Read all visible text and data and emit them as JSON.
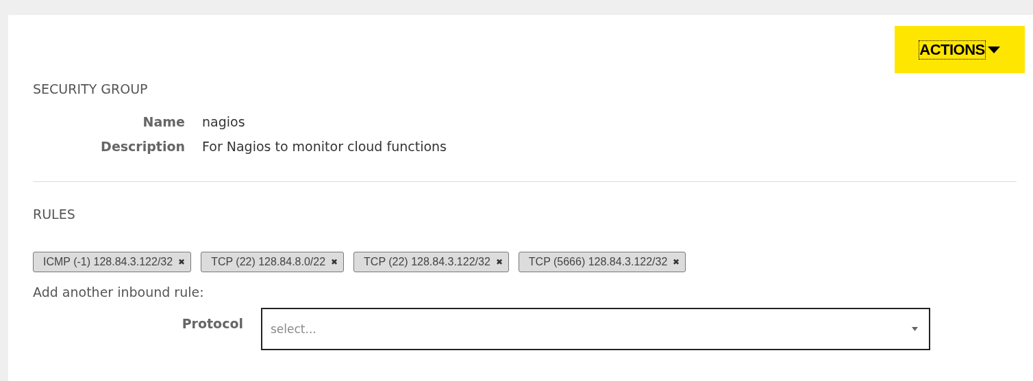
{
  "actions_button": {
    "label": "ACTIONS"
  },
  "security_group": {
    "heading": "SECURITY GROUP",
    "fields": [
      {
        "label": "Name",
        "value": "nagios"
      },
      {
        "label": "Description",
        "value": "For Nagios to monitor cloud functions"
      }
    ]
  },
  "rules": {
    "heading": "RULES",
    "tags": [
      {
        "label": "ICMP (-1) 128.84.3.122/32",
        "remove": "✖"
      },
      {
        "label": "TCP (22) 128.84.8.0/22",
        "remove": "✖"
      },
      {
        "label": "TCP (22) 128.84.3.122/32",
        "remove": "✖"
      },
      {
        "label": "TCP (5666) 128.84.3.122/32",
        "remove": "✖"
      }
    ],
    "add_label": "Add another inbound rule:",
    "protocol": {
      "label": "Protocol",
      "placeholder": "select..."
    }
  }
}
